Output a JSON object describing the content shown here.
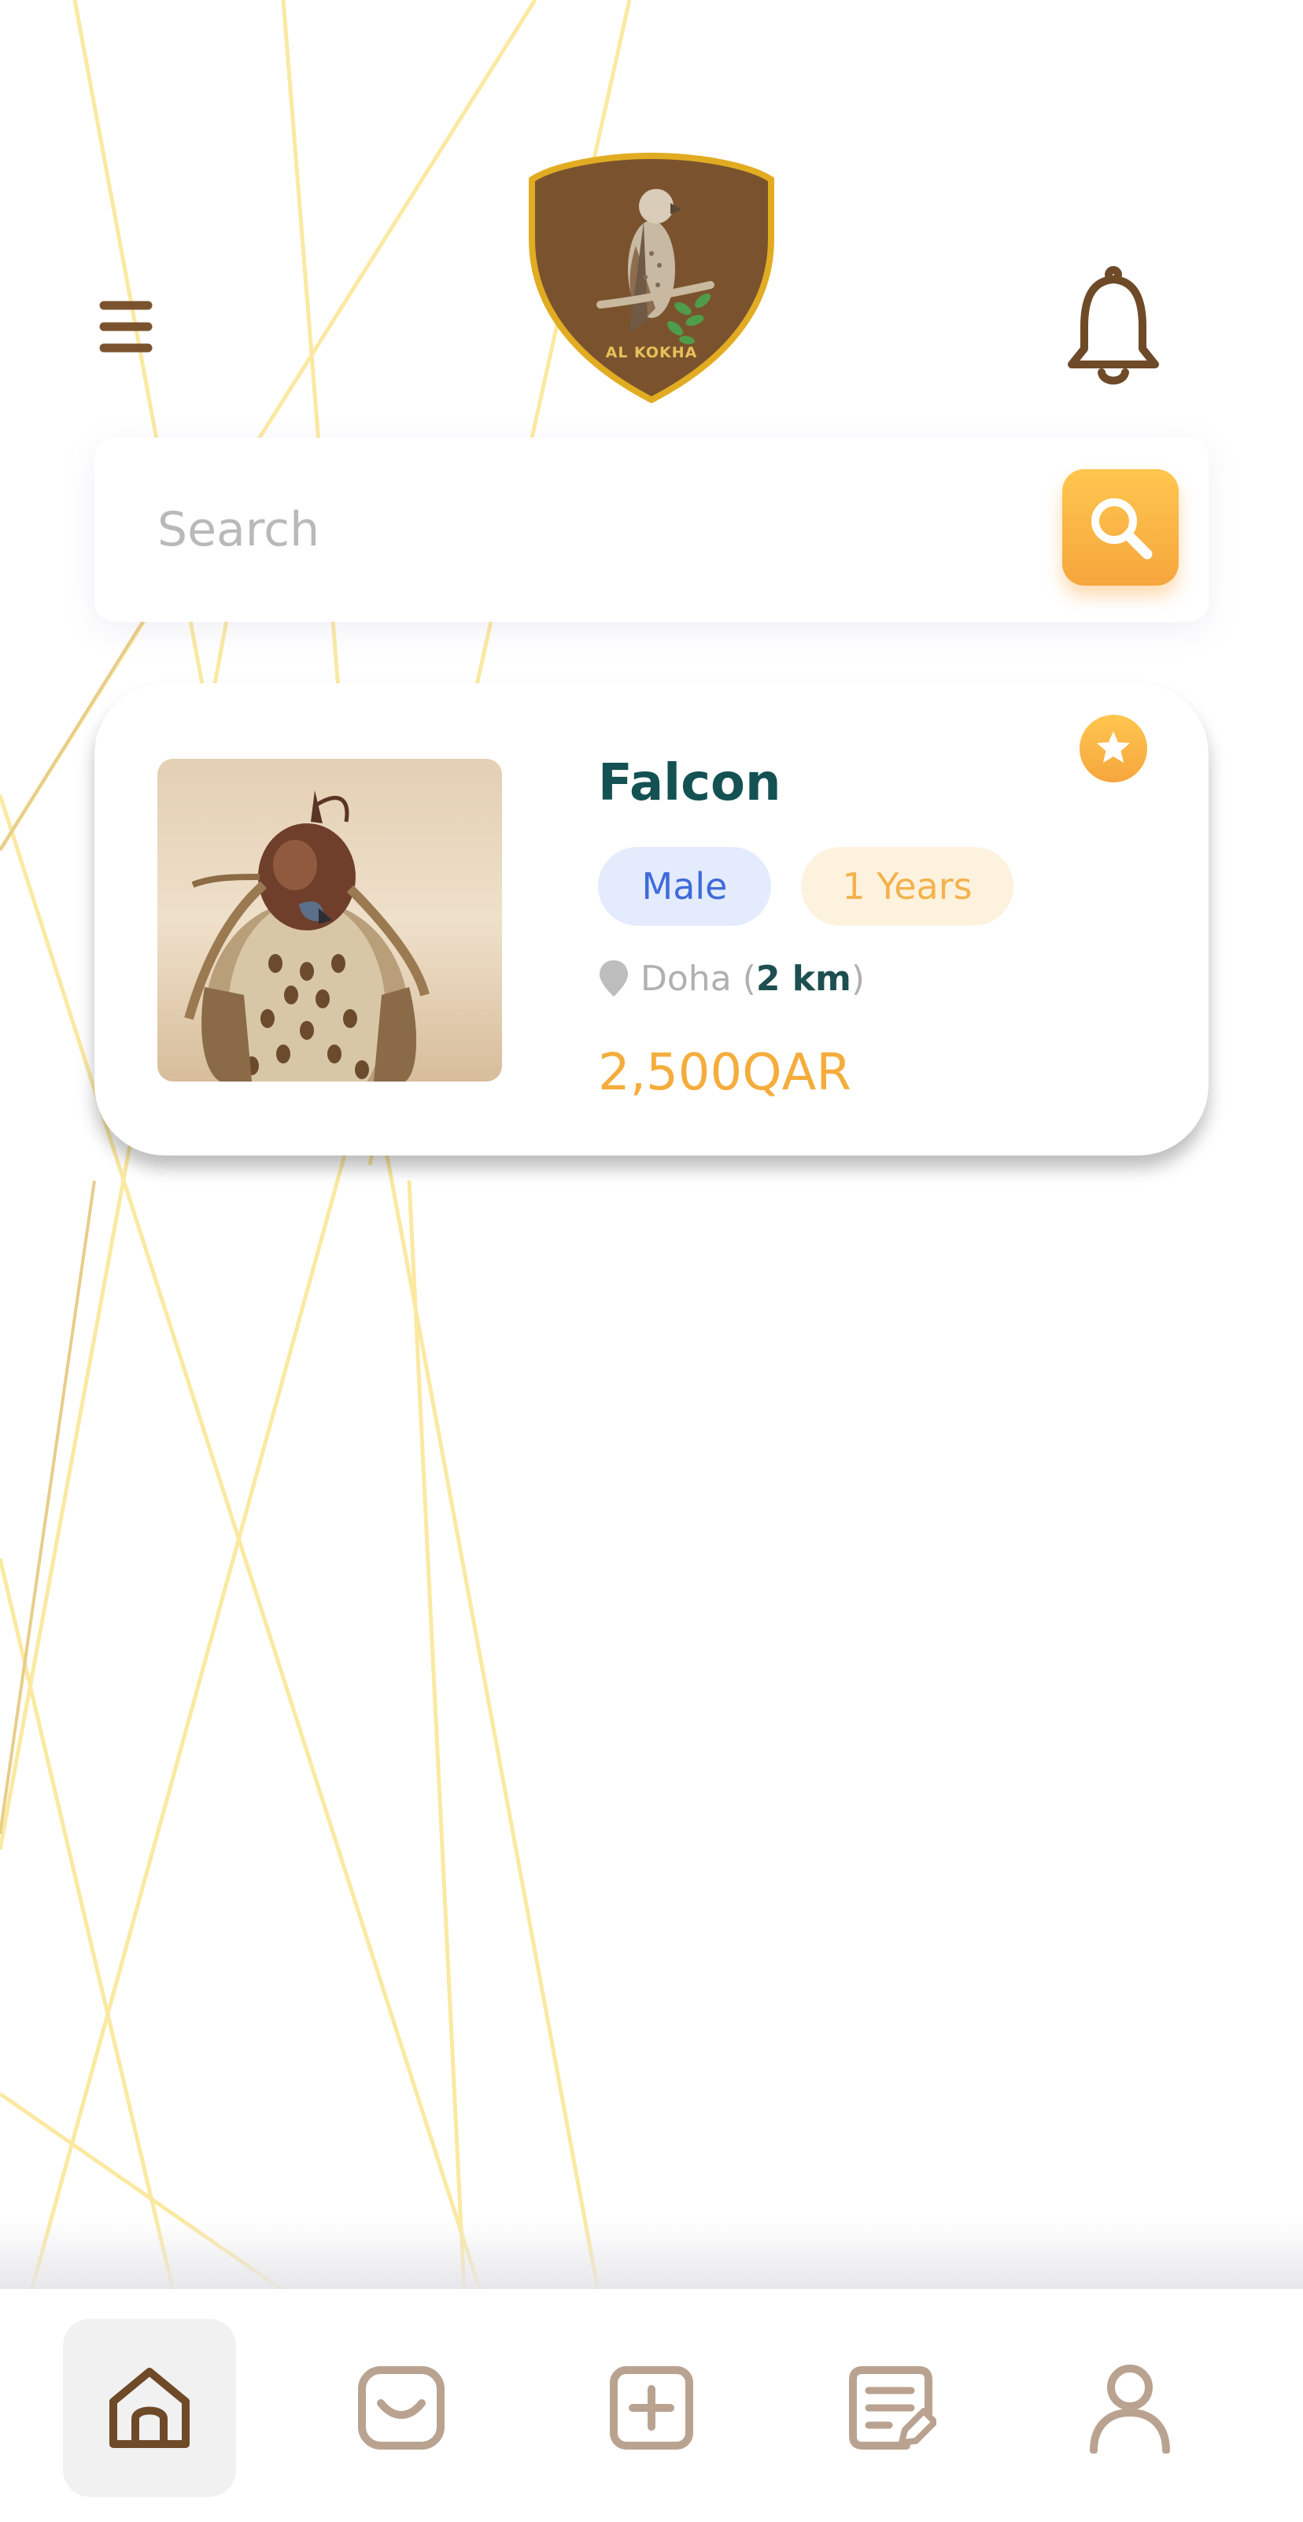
{
  "header": {
    "logo_text": "AL KOKHA"
  },
  "search": {
    "placeholder": "Search"
  },
  "listing": {
    "title": "Falcon",
    "gender": "Male",
    "age": "1 Years",
    "location_city": "Doha",
    "distance": "2 km",
    "price": "2,500QAR",
    "favorite": true
  },
  "bottom_nav": [
    {
      "name": "home",
      "active": true
    },
    {
      "name": "inbox",
      "active": false
    },
    {
      "name": "add-listing",
      "active": false
    },
    {
      "name": "my-listings",
      "active": false
    },
    {
      "name": "profile",
      "active": false
    }
  ],
  "colors": {
    "brand_brown": "#7a532e",
    "accent_orange": "#f6a63d",
    "title_teal": "#145152",
    "gender_blue": "#3f6bd9",
    "background_lines": "#fbe9a2"
  }
}
